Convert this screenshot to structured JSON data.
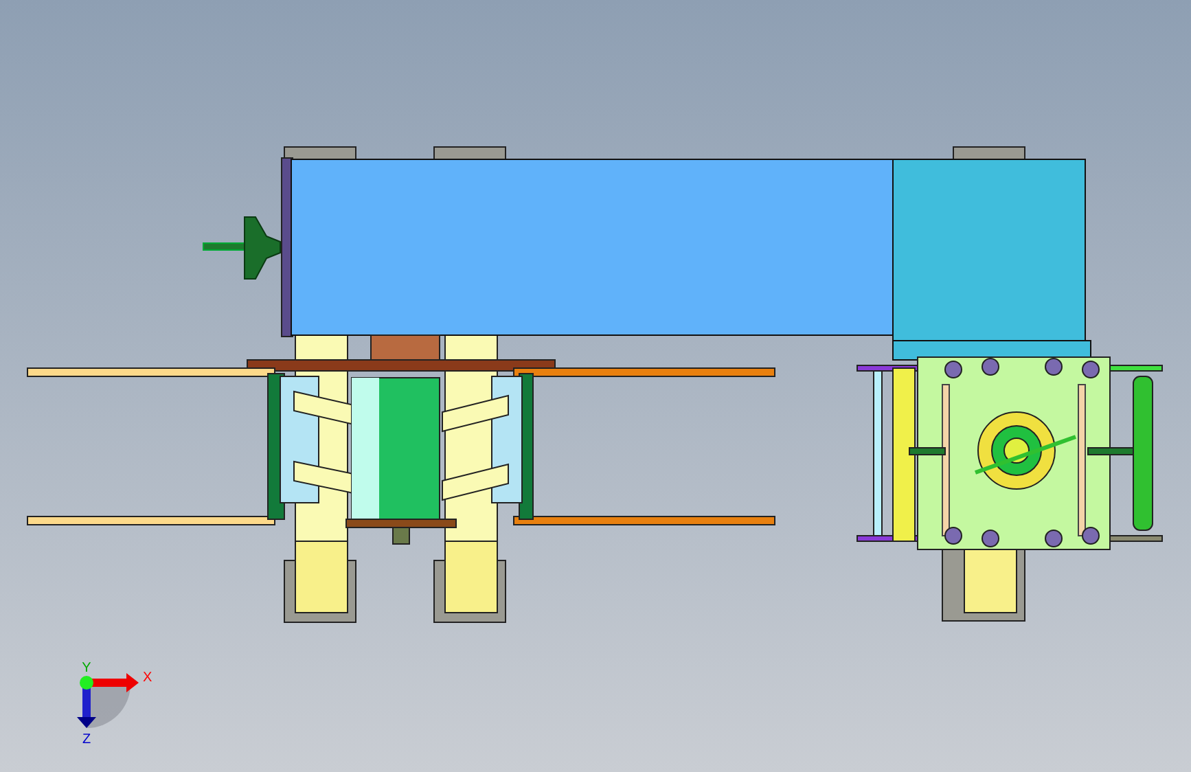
{
  "axis_triad": {
    "labels": [
      "X",
      "Y",
      "Z"
    ]
  }
}
